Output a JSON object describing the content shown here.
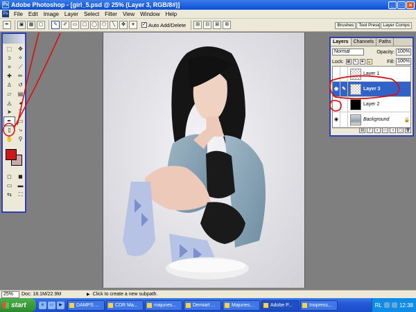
{
  "window": {
    "app_icon": "Ps",
    "title": "Adobe Photoshop - [girl_5.psd @ 25% (Layer 3, RGB/8#)]",
    "buttons": {
      "minimize": "_",
      "maximize": "□",
      "close": "×"
    }
  },
  "menu": {
    "items": [
      "File",
      "Edit",
      "Image",
      "Layer",
      "Select",
      "Filter",
      "View",
      "Window",
      "Help"
    ]
  },
  "options_bar": {
    "tool_icon": "pen-icon",
    "auto_add_delete_label": "Auto Add/Delete",
    "auto_add_delete_checked": "✓",
    "well_tabs": [
      "Brushes",
      "Tool Presets",
      "Layer Comps"
    ]
  },
  "layers_panel": {
    "tabs": [
      "Layers",
      "Channels",
      "Paths"
    ],
    "blend_mode": "Normal",
    "opacity_label": "Opacity:",
    "opacity_value": "100%",
    "lock_label": "Lock:",
    "fill_label": "Fill:",
    "fill_value": "100%",
    "layers": [
      {
        "name": "Layer 1",
        "visible": false,
        "selected": false,
        "thumb": "transparent"
      },
      {
        "name": "Layer 3",
        "visible": true,
        "selected": true,
        "thumb": "transparent"
      },
      {
        "name": "Layer 2",
        "visible": false,
        "selected": false,
        "thumb": "black"
      },
      {
        "name": "Background",
        "visible": true,
        "selected": false,
        "thumb": "photo",
        "locked": true
      }
    ]
  },
  "status_bar": {
    "zoom": "25%",
    "doc": "Doc: 18.1M/22.9M",
    "message": "Click to create a new subpath."
  },
  "taskbar": {
    "start_label": "start",
    "tasks": [
      {
        "label": "DAMPS ...",
        "active": false
      },
      {
        "label": "CDR Ma...",
        "active": false
      },
      {
        "label": "majunes...",
        "active": false
      },
      {
        "label": "Demiart ...",
        "active": false
      },
      {
        "label": "Majunes...",
        "active": false
      },
      {
        "label": "Adobe P...",
        "active": true
      },
      {
        "label": "Inopress...",
        "active": false
      }
    ],
    "tray_lang": "RL",
    "clock": "12:38"
  },
  "colors": {
    "foreground": "#d11818",
    "background": "#c8a8a8",
    "annotation": "#d81010",
    "selection": "#3162c8"
  }
}
